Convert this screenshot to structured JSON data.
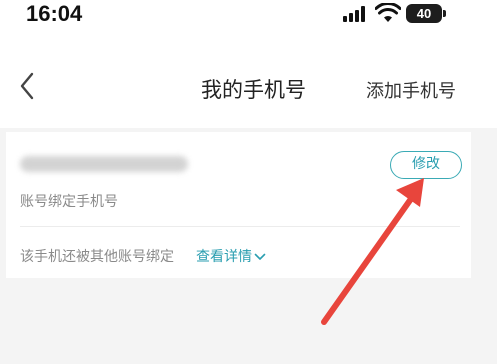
{
  "status_bar": {
    "time": "16:04",
    "battery": "40",
    "icons": [
      "signal-icon",
      "wifi-icon",
      "battery-icon"
    ]
  },
  "nav": {
    "back_icon": "chevron-left-icon",
    "title": "我的手机号",
    "add_link": "添加手机号"
  },
  "card": {
    "bind_label": "账号绑定手机号",
    "edit_button": "修改",
    "other_text": "该手机还被其他账号绑定",
    "detail_link": "查看详情",
    "detail_icon": "chevron-down-icon"
  },
  "colors": {
    "accent": "#2a9eb0",
    "arrow": "#e8453c",
    "background": "#f4f4f4"
  }
}
